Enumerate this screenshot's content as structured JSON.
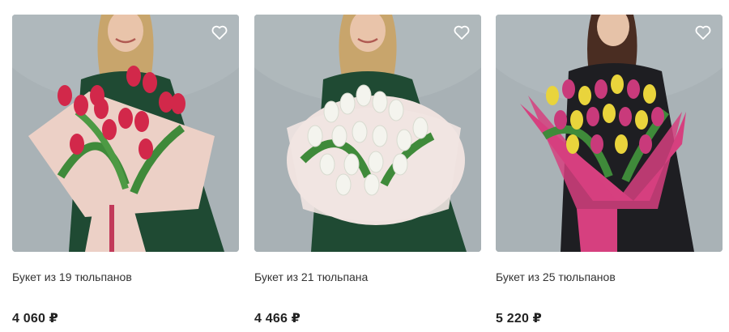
{
  "products": [
    {
      "title": "Букет из 19 тюльпанов",
      "price": "4 060 ₽",
      "image": {
        "flowers": "red tulips",
        "wrap": "pink paper",
        "hair": "blonde",
        "outfit": "green"
      },
      "colors": {
        "bg": "#a9b2b6",
        "outfit": "#1f4a33",
        "hair": "#c8a56c",
        "wrap": "#ecd0c6",
        "flower": "#d2284a"
      }
    },
    {
      "title": "Букет из 21 тюльпана",
      "price": "4 466 ₽",
      "image": {
        "flowers": "white tulips",
        "wrap": "light pink paper",
        "hair": "blonde",
        "outfit": "green"
      },
      "colors": {
        "bg": "#a8b1b5",
        "outfit": "#1f4a33",
        "hair": "#c8a56c",
        "wrap": "#efe2df",
        "flower": "#f4f4ee"
      }
    },
    {
      "title": "Букет из 25 тюльпанов",
      "price": "5 220 ₽",
      "image": {
        "flowers": "pink and yellow tulips",
        "wrap": "magenta paper",
        "hair": "dark",
        "outfit": "black"
      },
      "colors": {
        "bg": "#a9b2b6",
        "outfit": "#1e1e22",
        "hair": "#4a2d22",
        "wrap": "#d6407f",
        "flower": "#e9d43c"
      }
    }
  ],
  "icons": {
    "favorite": "heart-outline-icon"
  }
}
